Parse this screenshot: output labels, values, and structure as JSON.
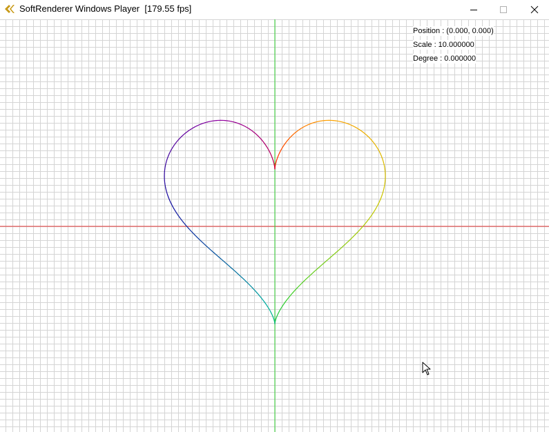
{
  "window": {
    "title": "SoftRenderer Windows Player  [179.55 fps]",
    "icon": "ck-logo-icon",
    "controls": {
      "minimize_icon": "minimize-icon",
      "maximize_icon": "maximize-icon",
      "close_icon": "close-icon"
    }
  },
  "overlay": {
    "position_text": "Position : (0.000, 0.000)",
    "scale_text": "Scale : 10.000000",
    "degree_text": "Degree : 0.000000"
  },
  "scene": {
    "background_color": "#ffffff",
    "grid_color": "#d4d4d4",
    "x_axis_color": "#e03030",
    "y_axis_color": "#30d030",
    "shape": "heart",
    "gradient_colors": [
      "#ff0000",
      "#ffa000",
      "#c8c800",
      "#30d030",
      "#00b0a0",
      "#1010a0",
      "#9000a0",
      "#d0003a"
    ],
    "cursor_icon": "mouse-pointer-icon"
  }
}
